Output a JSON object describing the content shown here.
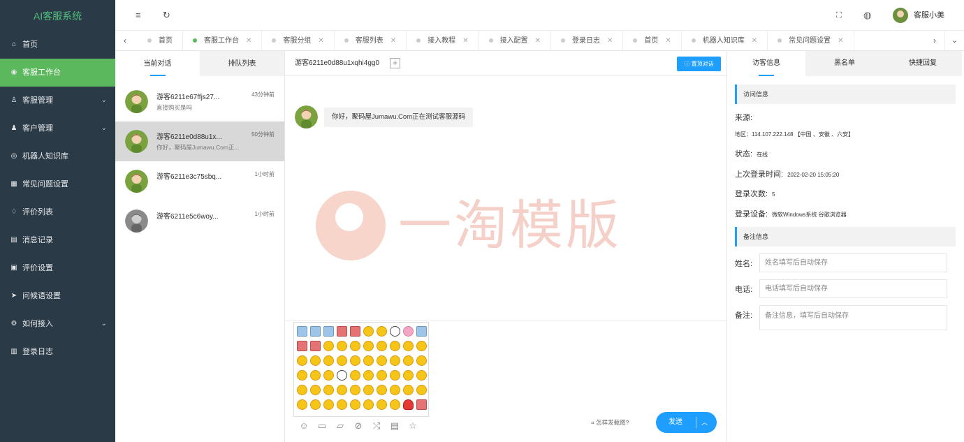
{
  "app": {
    "title": "AI客服系统"
  },
  "sidebar": {
    "items": [
      {
        "label": "首页",
        "icon": "home-icon",
        "active": false
      },
      {
        "label": "客服工作台",
        "icon": "dashboard-icon",
        "active": true
      },
      {
        "label": "客服管理",
        "icon": "user-icon",
        "active": false,
        "expandable": true
      },
      {
        "label": "客户管理",
        "icon": "customer-icon",
        "active": false,
        "expandable": true
      },
      {
        "label": "机器人知识库",
        "icon": "robot-icon",
        "active": false
      },
      {
        "label": "常见问题设置",
        "icon": "faq-icon",
        "active": false
      },
      {
        "label": "评价列表",
        "icon": "thumbs-up-icon",
        "active": false
      },
      {
        "label": "消息记录",
        "icon": "message-log-icon",
        "active": false
      },
      {
        "label": "评价设置",
        "icon": "rating-settings-icon",
        "active": false
      },
      {
        "label": "问候语设置",
        "icon": "send-icon",
        "active": false
      },
      {
        "label": "如何接入",
        "icon": "settings-icon",
        "active": false,
        "expandable": true
      },
      {
        "label": "登录日志",
        "icon": "log-icon",
        "active": false
      }
    ]
  },
  "topbar": {
    "user_name": "客服小美",
    "menu_icon": "≡",
    "refresh_icon": "↻",
    "fullscreen_icon": "⛶",
    "globe_icon": "◍"
  },
  "tabs": [
    {
      "label": "首页",
      "active": false
    },
    {
      "label": "客服工作台",
      "active": true
    },
    {
      "label": "客服分组",
      "active": false
    },
    {
      "label": "客服列表",
      "active": false
    },
    {
      "label": "接入教程",
      "active": false
    },
    {
      "label": "接入配置",
      "active": false
    },
    {
      "label": "登录日志",
      "active": false
    },
    {
      "label": "首页",
      "active": false
    },
    {
      "label": "机器人知识库",
      "active": false
    },
    {
      "label": "常见问题设置",
      "active": false
    }
  ],
  "left_panel": {
    "tabs": [
      "当前对话",
      "排队列表"
    ],
    "conversations": [
      {
        "name": "游客6211e67ffjs27...",
        "time": "43分钟前",
        "message": "直接购买是吗",
        "selected": false,
        "avatar": "color"
      },
      {
        "name": "游客6211e0d88u1x...",
        "time": "50分钟前",
        "message": "你好，聚码屋Jumawu.Com正...",
        "selected": true,
        "avatar": "color"
      },
      {
        "name": "游客6211e3c75sbq...",
        "time": "1小时前",
        "message": "",
        "selected": false,
        "avatar": "color"
      },
      {
        "name": "游客6211e5c6woy...",
        "time": "1小时前",
        "message": "",
        "selected": false,
        "avatar": "gray"
      }
    ]
  },
  "chat": {
    "visitor_title": "游客6211e0d88u1xqhi4gg0",
    "top_button": "置顶对话",
    "message": "你好，聚码屋Jumawu.Com正在测试客服源码",
    "watermark": "一淘模版",
    "screenshot_hint": "怎样发截图?",
    "send_label": "发送"
  },
  "right_panel": {
    "tabs": [
      "访客信息",
      "黑名单",
      "快捷回复"
    ],
    "visit_section": "访问信息",
    "source_label": "来源:",
    "region": "地区：114.107.222.148 【中国 、安徽 、六安】",
    "status_label": "状态:",
    "status_value": "在线",
    "last_login_label": "上次登录时间:",
    "last_login_value": "2022-02-20 15:05:20",
    "login_count_label": "登录次数:",
    "login_count_value": "5",
    "device_label": "登录设备:",
    "device_value": "微软Windows系统 谷歌浏览器",
    "notes_section": "备注信息",
    "name_label": "姓名:",
    "name_placeholder": "姓名填写后自动保存",
    "phone_label": "电话:",
    "phone_placeholder": "电话填写后自动保存",
    "remark_label": "备注:",
    "remark_placeholder": "备注信息，填写后自动保存"
  }
}
